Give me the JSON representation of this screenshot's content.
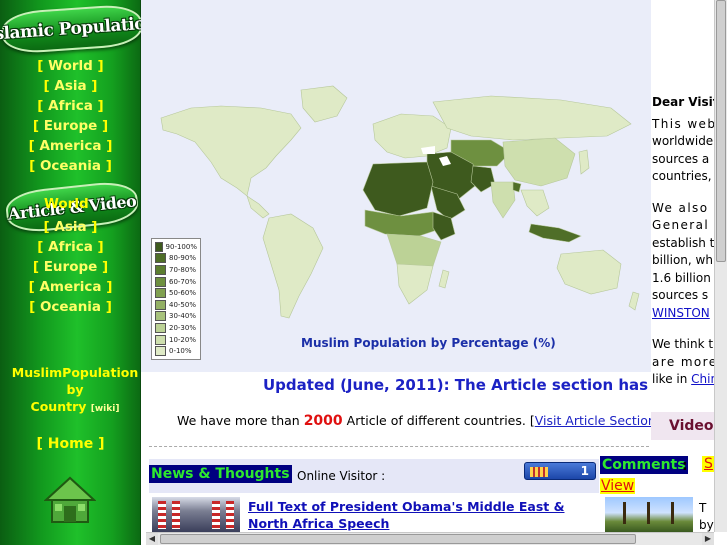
{
  "sidebar": {
    "banner_top": "Islamic Population",
    "regions": [
      {
        "label": "World"
      },
      {
        "label": "Asia"
      },
      {
        "label": "Africa"
      },
      {
        "label": "Europe"
      },
      {
        "label": "America"
      },
      {
        "label": "Oceania"
      }
    ],
    "banner_mid": "Article & Video",
    "article_overlap_word": "World",
    "article_regions": [
      {
        "label": "Asia"
      },
      {
        "label": "Africa"
      },
      {
        "label": "Europe"
      },
      {
        "label": "America"
      },
      {
        "label": "Oceania"
      }
    ],
    "wiki_line1": "MuslimPopulation by",
    "wiki_line2": "Country",
    "wiki_tag": "[wiki]",
    "home_label": "Home",
    "home_icon": "house-icon"
  },
  "map": {
    "caption": "Muslim Population by Percentage (%)",
    "legend": [
      {
        "label": "90-100%",
        "color": "#3e5a1e"
      },
      {
        "label": "80-90%",
        "color": "#4f6e28"
      },
      {
        "label": "70-80%",
        "color": "#5c7e30"
      },
      {
        "label": "60-70%",
        "color": "#6e9040"
      },
      {
        "label": "50-60%",
        "color": "#80a050"
      },
      {
        "label": "40-50%",
        "color": "#93b064"
      },
      {
        "label": "30-40%",
        "color": "#a8c27c"
      },
      {
        "label": "20-30%",
        "color": "#bcd296"
      },
      {
        "label": "10-20%",
        "color": "#cedfae"
      },
      {
        "label": "0-10%",
        "color": "#dfeac6"
      }
    ]
  },
  "letter": {
    "title": "Dear Visit",
    "p1": [
      "This webp",
      "worldwide.",
      "sources a",
      "countries,"
    ],
    "p2": [
      "We also w",
      "General S",
      "establish t",
      "billion, wh",
      "1.6 billion",
      "sources s"
    ],
    "p2_link": "WINSTON",
    "p3": [
      "We think t",
      "are more"
    ],
    "p3_tail": "like in",
    "p3_link": "Chin"
  },
  "updated": "Updated (June, 2011): The Article section has",
  "article_count": {
    "prefix": "We have more than",
    "count": "2000",
    "suffix": "Article of different countries. [",
    "link": "Visit Article Section",
    "close": "]"
  },
  "video_tab": "Video",
  "news": {
    "title": "News & Thoughts",
    "online_label": "Online Visitor :",
    "online_count": "1",
    "headline": "Full Text of President Obama's Middle East & North Africa Speech"
  },
  "comments": {
    "title": "Comments",
    "separator": ":",
    "more": "S",
    "view": "View",
    "snippet_lines": [
      "T",
      "by"
    ]
  }
}
